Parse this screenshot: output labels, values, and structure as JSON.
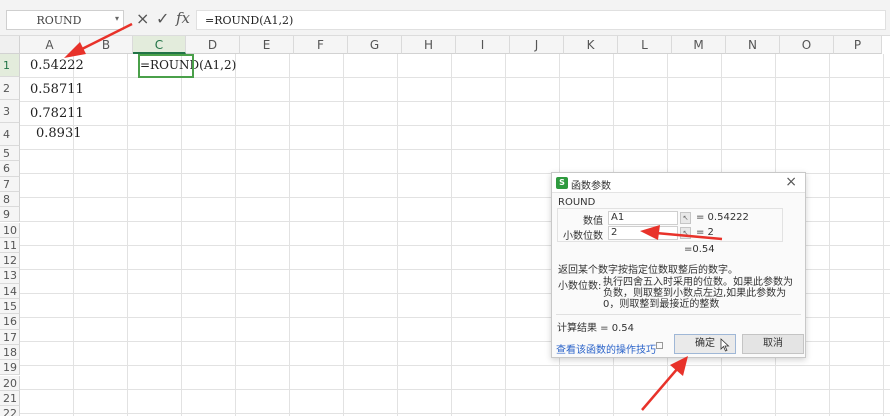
{
  "formula_bar": {
    "name_box": "ROUND",
    "cancel_icon": "×",
    "confirm_icon": "✓",
    "fx_icon": "fx",
    "formula": "=ROUND(A1,2)"
  },
  "grid": {
    "columns": [
      "A",
      "B",
      "C",
      "D",
      "E",
      "F",
      "G",
      "H",
      "I",
      "J",
      "K",
      "L",
      "M",
      "N",
      "O",
      "P"
    ],
    "rows": [
      "1",
      "2",
      "3",
      "4",
      "5",
      "6",
      "7",
      "8",
      "9",
      "10",
      "11",
      "12",
      "13",
      "14",
      "15",
      "16",
      "17",
      "18",
      "19",
      "20",
      "21",
      "22"
    ],
    "active_column": "C",
    "active_row": "1",
    "cells": {
      "A1": "0.54222",
      "A2": "0.58711",
      "A3": "0.78211",
      "A4": "0.8931",
      "C1": "=ROUND(A1,2)"
    }
  },
  "dialog": {
    "title": "函数参数",
    "function_name": "ROUND",
    "args": [
      {
        "label": "数值",
        "value": "A1",
        "result": "= 0.54222"
      },
      {
        "label": "小数位数",
        "value": "2",
        "result": "= 2"
      }
    ],
    "result_preview": "=0.54",
    "description": "返回某个数字按指定位数取整后的数字。",
    "param_label": "小数位数:",
    "param_description": "执行四舍五入时采用的位数。如果此参数为负数，则取整到小数点左边,如果此参数为0，则取整到最接近的整数",
    "calc_result": "计算结果 = 0.54",
    "help_link": "查看该函数的操作技巧",
    "ok": "确定",
    "cancel": "取消"
  },
  "colors": {
    "accent_green": "#217346",
    "annotation_red": "#e8322a",
    "link_blue": "#2a63c9"
  }
}
